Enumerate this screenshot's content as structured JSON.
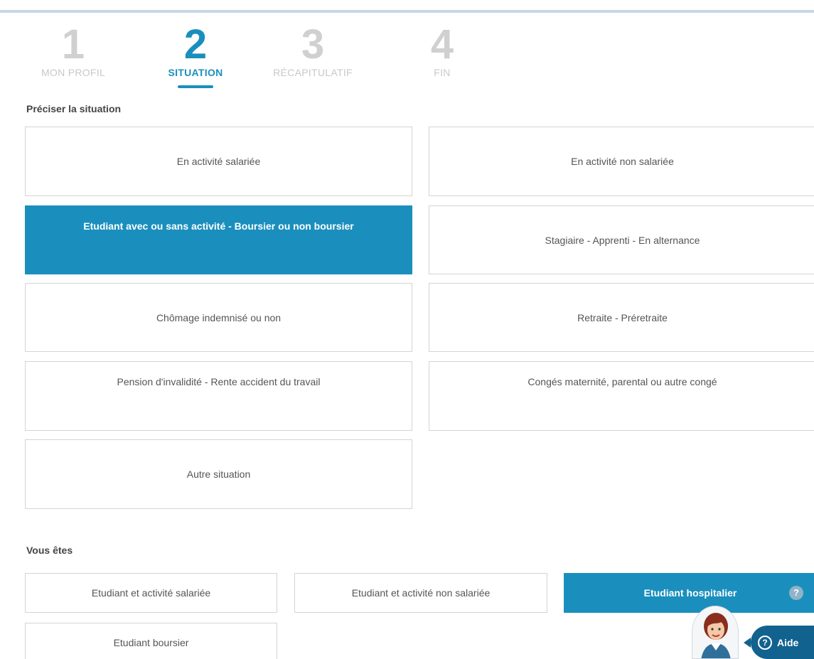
{
  "steps": [
    {
      "number": "1",
      "label": "MON PROFIL"
    },
    {
      "number": "2",
      "label": "SITUATION"
    },
    {
      "number": "3",
      "label": "RÉCAPITULATIF"
    },
    {
      "number": "4",
      "label": "FIN"
    }
  ],
  "situation": {
    "heading": "Préciser la situation",
    "options": [
      "En activité salariée",
      "En activité non salariée",
      "Etudiant avec ou sans activité - Boursier ou non boursier",
      "Stagiaire - Apprenti - En alternance",
      "Chômage indemnisé ou non",
      "Retraite - Préretraite",
      "Pension d'invalidité - Rente accident du travail",
      "Congés maternité, parental ou autre congé",
      "Autre situation"
    ],
    "selected": "Etudiant avec ou sans activité - Boursier ou non boursier"
  },
  "vous_etes": {
    "heading": "Vous êtes",
    "options": [
      "Etudiant et activité salariée",
      "Etudiant et activité non salariée",
      "Etudiant hospitalier",
      "Etudiant boursier"
    ],
    "selected": "Etudiant hospitalier",
    "help_glyph": "?"
  },
  "help": {
    "label": "Aide",
    "icon_glyph": "?"
  },
  "colors": {
    "accent": "#1a8fbd",
    "help_button": "#12628f"
  }
}
